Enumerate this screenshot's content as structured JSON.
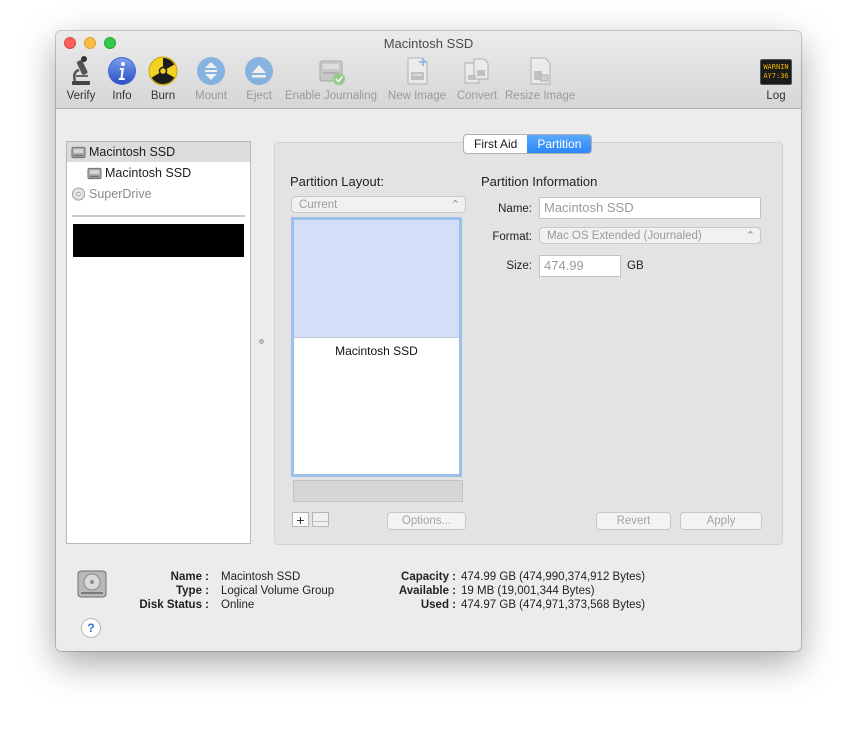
{
  "window": {
    "title": "Macintosh SSD"
  },
  "toolbar": [
    {
      "name": "verify",
      "label": "Verify",
      "icon": "microscope-icon",
      "enabled": true
    },
    {
      "name": "info",
      "label": "Info",
      "icon": "info-icon",
      "enabled": true
    },
    {
      "name": "burn",
      "label": "Burn",
      "icon": "radiation-icon",
      "enabled": true
    },
    {
      "name": "mount",
      "label": "Mount",
      "icon": "mount-icon",
      "enabled": false
    },
    {
      "name": "eject",
      "label": "Eject",
      "icon": "eject-icon",
      "enabled": false
    },
    {
      "name": "enable-journaling",
      "label": "Enable Journaling",
      "icon": "journaling-disk-icon",
      "enabled": false
    },
    {
      "name": "new-image",
      "label": "New Image",
      "icon": "new-image-icon",
      "enabled": false
    },
    {
      "name": "convert",
      "label": "Convert",
      "icon": "convert-icon",
      "enabled": false
    },
    {
      "name": "resize-image",
      "label": "Resize Image",
      "icon": "resize-image-icon",
      "enabled": false
    },
    {
      "name": "log",
      "label": "Log",
      "icon": "log-console-icon",
      "enabled": true,
      "icon_text": [
        "WARNIN",
        "AY7:36"
      ]
    }
  ],
  "sidebar": {
    "items": [
      {
        "label": "Macintosh SSD",
        "level": 0,
        "selected": true
      },
      {
        "label": "Macintosh SSD",
        "level": 1,
        "selected": false
      },
      {
        "label": "SuperDrive",
        "level": 0,
        "selected": false,
        "dimmed": true
      }
    ]
  },
  "tabs": [
    {
      "label": "First Aid",
      "active": false
    },
    {
      "label": "Partition",
      "active": true
    }
  ],
  "partition": {
    "layout_heading": "Partition Layout:",
    "layout_selected": "Current",
    "partition_label": "Macintosh SSD",
    "options_label": "Options...",
    "plus": "+",
    "minus": "—",
    "info_heading": "Partition Information",
    "name_label": "Name:",
    "name_value": "Macintosh SSD",
    "format_label": "Format:",
    "format_value": "Mac OS Extended (Journaled)",
    "size_label": "Size:",
    "size_value": "474.99",
    "size_unit": "GB",
    "revert_label": "Revert",
    "apply_label": "Apply"
  },
  "disk_info": {
    "left": [
      {
        "label": "Name :",
        "value": "Macintosh SSD"
      },
      {
        "label": "Type :",
        "value": "Logical Volume Group"
      },
      {
        "label": "Disk Status :",
        "value": "Online"
      }
    ],
    "right": [
      {
        "label": "Capacity :",
        "value": "474.99 GB (474,990,374,912 Bytes)"
      },
      {
        "label": "Available :",
        "value": "19 MB (19,001,344 Bytes)"
      },
      {
        "label": "Used :",
        "value": "474.97 GB (474,971,373,568 Bytes)"
      }
    ],
    "help": "?"
  },
  "colors": {
    "accent": "#2b87f8",
    "free_space": "#d5def7",
    "layout_border": "#9dc0ea"
  }
}
